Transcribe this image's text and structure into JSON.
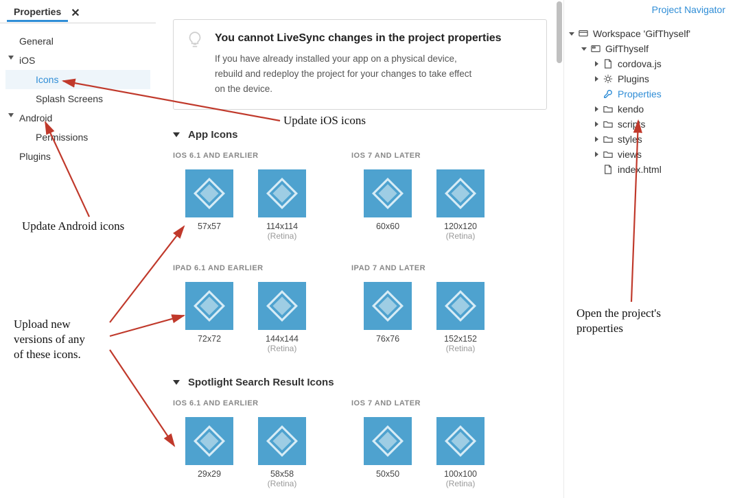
{
  "tab": {
    "title": "Properties"
  },
  "nav": {
    "general": "General",
    "ios": "iOS",
    "icons": "Icons",
    "splash": "Splash Screens",
    "android": "Android",
    "permissions": "Permissions",
    "plugins": "Plugins"
  },
  "notice": {
    "title": "You cannot LiveSync changes in the project properties",
    "l1": "If you have already installed your app on a physical device,",
    "l2": "rebuild and redeploy the project for your changes to take effect",
    "l3": "on the device."
  },
  "sections": {
    "app_icons": "App Icons",
    "spotlight": "Spotlight Search Result Icons"
  },
  "labels": {
    "ios61": "IOS 6.1 AND EARLIER",
    "ios7": "IOS 7 AND LATER",
    "ipad61": "IPAD 6.1 AND EARLIER",
    "ipad7": "IPAD 7 AND LATER",
    "retina": "(Retina)"
  },
  "app_icons_row1": {
    "a": {
      "s1": "57x57",
      "s2": "114x114"
    },
    "b": {
      "s1": "60x60",
      "s2": "120x120"
    }
  },
  "app_icons_row2": {
    "a": {
      "s1": "72x72",
      "s2": "144x144"
    },
    "b": {
      "s1": "76x76",
      "s2": "152x152"
    }
  },
  "spotlight_row": {
    "a": {
      "s1": "29x29",
      "s2": "58x58"
    },
    "b": {
      "s1": "50x50",
      "s2": "100x100"
    }
  },
  "right": {
    "title": "Project Navigator",
    "workspace": "Workspace 'GifThyself'",
    "project": "GifThyself",
    "cordova": "cordova.js",
    "plugins": "Plugins",
    "properties": "Properties",
    "kendo": "kendo",
    "scripts": "scripts",
    "styles": "styles",
    "views": "views",
    "index": "index.html"
  },
  "ann": {
    "a1": "Update iOS icons",
    "a2": "Update Android icons",
    "a3a": "Upload new",
    "a3b": "versions of any",
    "a3c": "of these icons.",
    "a4a": "Open the project's",
    "a4b": "properties"
  }
}
